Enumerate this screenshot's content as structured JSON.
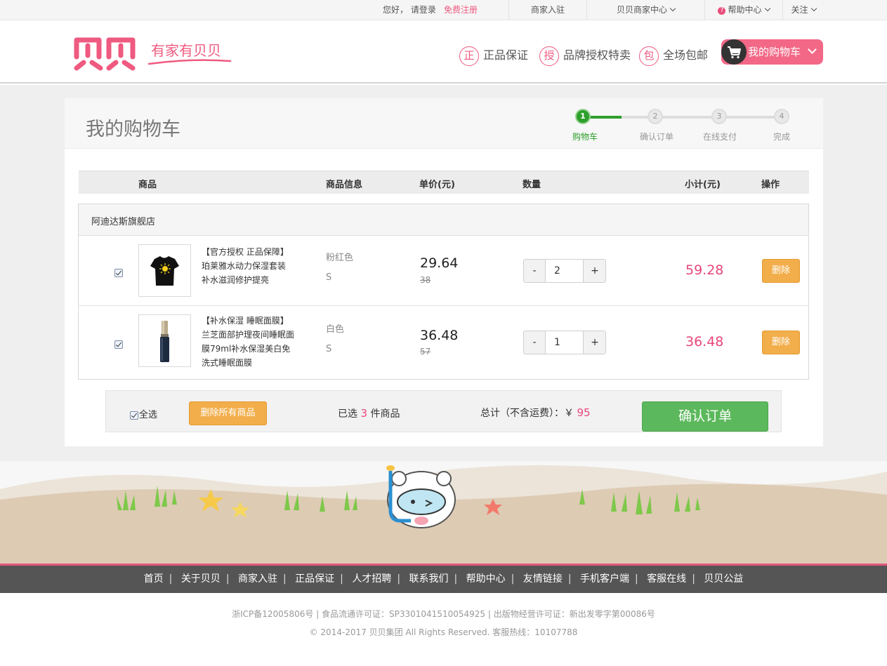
{
  "topbar": {
    "greeting": "您好， 请登录",
    "register": "免费注册",
    "merchant_join": "商家入驻",
    "merchant_center": "贝贝商家中心",
    "help_center": "帮助中心",
    "follow": "关注"
  },
  "header": {
    "logo_text": "贝贝",
    "slogan": "有家有贝贝",
    "features": [
      {
        "icon": "正",
        "label": "正品保证"
      },
      {
        "icon": "授",
        "label": "品牌授权特卖"
      },
      {
        "icon": "包",
        "label": "全场包邮"
      }
    ],
    "cart_label": "我的购物车"
  },
  "page": {
    "title": "我的购物车",
    "steps": [
      {
        "num": "1",
        "label": "购物车",
        "active": true
      },
      {
        "num": "2",
        "label": "确认订单",
        "active": false
      },
      {
        "num": "3",
        "label": "在线支付",
        "active": false
      },
      {
        "num": "4",
        "label": "完成",
        "active": false
      }
    ]
  },
  "table": {
    "columns": [
      "商品",
      "商品信息",
      "单价(元)",
      "数量",
      "小计(元)",
      "操作"
    ]
  },
  "shop": {
    "name": "阿迪达斯旗舰店",
    "items": [
      {
        "checked": true,
        "name": "【官方授权 正品保障】珀莱雅水动力保湿套装补水滋润修护提亮",
        "name_lines": [
          "【官方授权 正品保障】",
          "珀莱雅水动力保湿套装",
          "补水滋润修护提亮"
        ],
        "color": "粉红色",
        "size": "S",
        "price": "29.64",
        "original_price": "38",
        "quantity": "2",
        "subtotal": "59.28",
        "delete_label": "删除",
        "thumb": "tshirt"
      },
      {
        "checked": true,
        "name": "【补水保湿 睡眠面膜】兰芝面部护理夜间睡眠面膜79ml补水保湿美白免洗式睡眠面膜",
        "name_lines": [
          "【补水保湿 睡眠面膜】",
          "兰芝面部护理夜间睡眠面",
          "膜79ml补水保湿美白免",
          "洗式睡眠面膜"
        ],
        "color": "白色",
        "size": "S",
        "price": "36.48",
        "original_price": "57",
        "quantity": "1",
        "subtotal": "36.48",
        "delete_label": "删除",
        "thumb": "bottle"
      }
    ]
  },
  "summary": {
    "select_all": "全选",
    "delete_all": "删除所有商品",
    "selected_prefix": "已选",
    "selected_count": "3",
    "selected_suffix": "件商品",
    "total_label": "总计（不含运费）：￥",
    "total_amount": "95",
    "confirm_label": "确认订单"
  },
  "footer": {
    "nav": [
      "首页",
      "关于贝贝",
      "商家入驻",
      "正品保证",
      "人才招聘",
      "联系我们",
      "帮助中心",
      "友情链接",
      "手机客户端",
      "客服在线",
      "贝贝公益"
    ],
    "license": "浙ICP备12005806号 | 食品流通许可证：SP3301041510054925 | 出版物经营许可证：新出发零字第00086号",
    "copyright": "© 2014-2017 贝贝集团 All Rights Reserved. 客服热线：10107788"
  },
  "colors": {
    "brand_pink": "#ef5a80",
    "price_pink": "#e8467a",
    "step_green": "#2da02b",
    "confirm_green": "#5cb85c",
    "delete_orange": "#f2ae4b",
    "footer_gray": "#555555"
  },
  "icons": {
    "cart": "cart-icon",
    "help": "help-icon",
    "chevron": "chevron-down-icon"
  }
}
